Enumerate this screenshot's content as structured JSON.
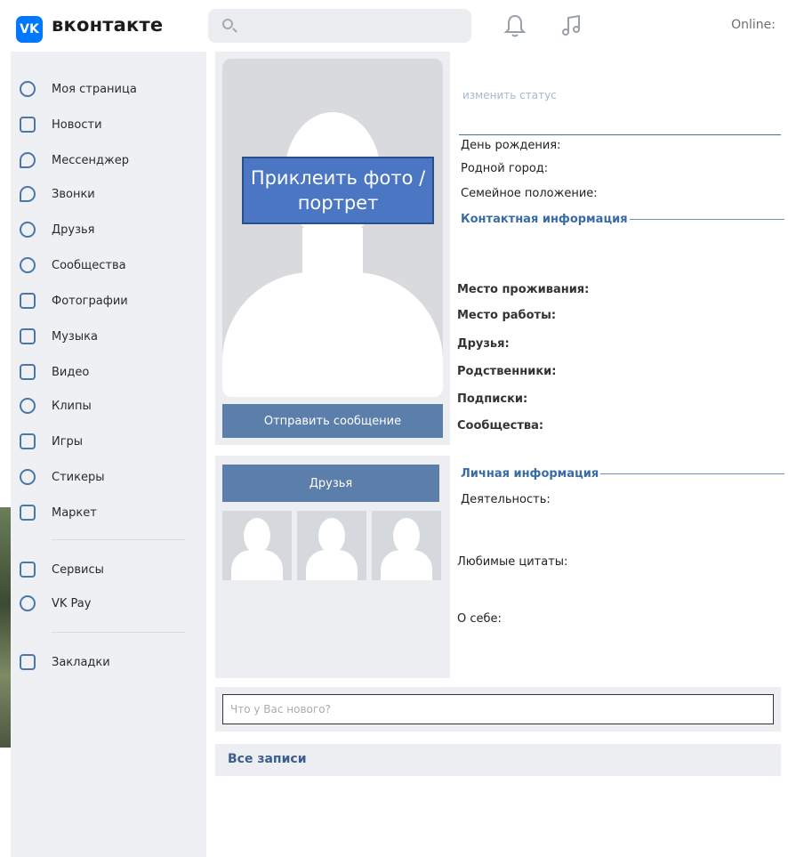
{
  "header": {
    "logo_mark": "VK",
    "logo_text": "вконтакте",
    "online_label": "Online:"
  },
  "sidebar": {
    "items": [
      {
        "label": "Моя страница"
      },
      {
        "label": "Новости"
      },
      {
        "label": "Мессенджер"
      },
      {
        "label": "Звонки"
      },
      {
        "label": "Друзья"
      },
      {
        "label": "Сообщества"
      },
      {
        "label": "Фотографии"
      },
      {
        "label": "Музыка"
      },
      {
        "label": "Видео"
      },
      {
        "label": "Клипы"
      },
      {
        "label": "Игры"
      },
      {
        "label": "Стикеры"
      },
      {
        "label": "Маркет"
      }
    ],
    "extra": [
      {
        "label": "Сервисы"
      },
      {
        "label": "VK Pay"
      }
    ],
    "bookmarks": {
      "label": "Закладки"
    }
  },
  "profile": {
    "photo_placeholder": "Приклеить фото / портрет",
    "send_message": "Отправить сообщение",
    "friends_button": "Друзья",
    "status_link": "изменить статус",
    "fields_basic": {
      "birthday": "День рождения:",
      "hometown": "Родной город:",
      "family": "Семейное положение:"
    },
    "contact_title": "Контактная информация",
    "fields_contact": {
      "residence": "Место проживания:",
      "work": "Место работы:",
      "friends": "Друзья:",
      "relatives": "Родственники:",
      "subscriptions": "Подписки:",
      "communities": "Сообщества:"
    },
    "personal_title": "Личная информация",
    "fields_personal": {
      "activity": "Деятельность:",
      "quotes": "Любимые цитаты:",
      "about": "О себе:"
    }
  },
  "wall": {
    "post_placeholder": "Что у Вас нового?",
    "all_posts": "Все записи"
  }
}
